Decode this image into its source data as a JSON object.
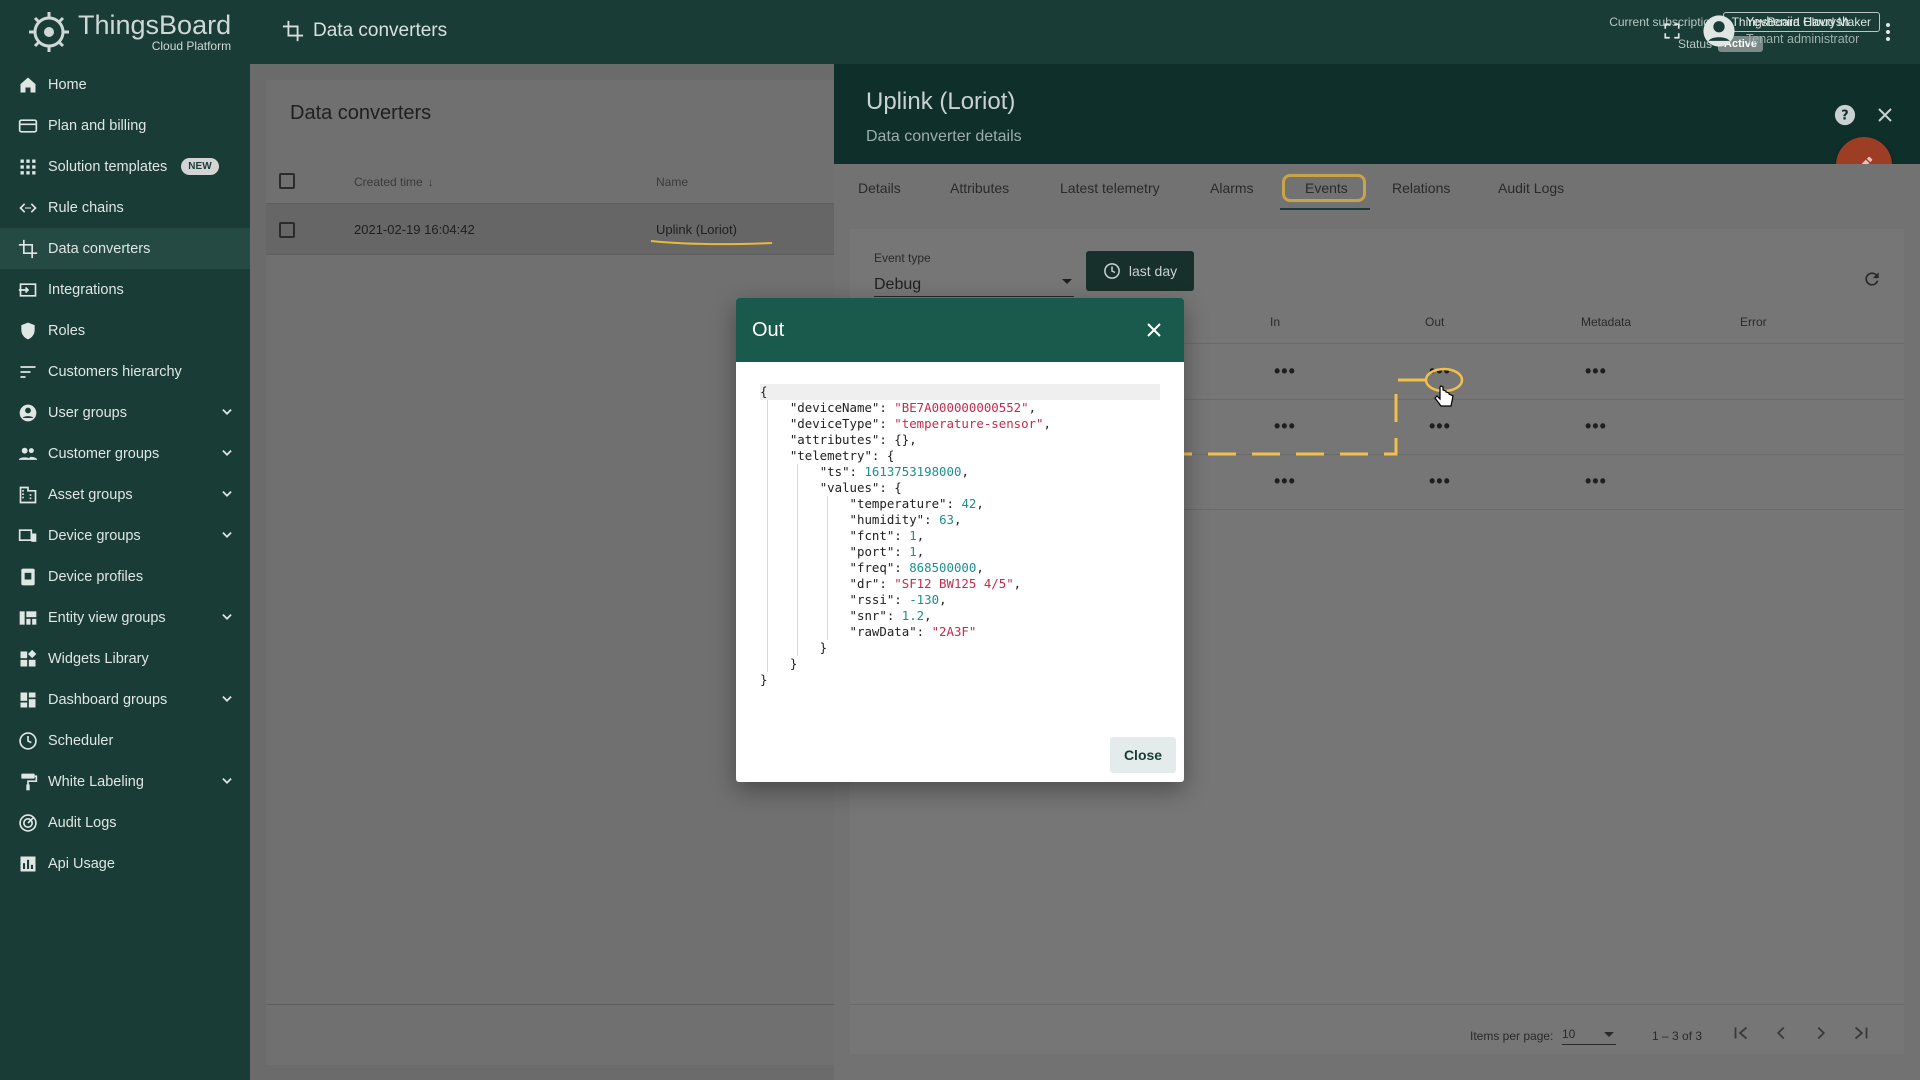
{
  "app": {
    "logo_title": "ThingsBoard",
    "logo_sub": "Cloud Platform"
  },
  "sidebar": {
    "items": [
      {
        "label": "Home",
        "icon": "home-icon"
      },
      {
        "label": "Plan and billing",
        "icon": "credit-card-icon"
      },
      {
        "label": "Solution templates",
        "icon": "apps-grid-icon",
        "badge": "NEW"
      },
      {
        "label": "Rule chains",
        "icon": "code-arrows-icon"
      },
      {
        "label": "Data converters",
        "icon": "crop-icon"
      },
      {
        "label": "Integrations",
        "icon": "input-icon"
      },
      {
        "label": "Roles",
        "icon": "shield-icon"
      },
      {
        "label": "Customers hierarchy",
        "icon": "sort-lines-icon"
      },
      {
        "label": "User groups",
        "icon": "account-circle-icon"
      },
      {
        "label": "Customer groups",
        "icon": "people-icon"
      },
      {
        "label": "Asset groups",
        "icon": "domain-icon"
      },
      {
        "label": "Device groups",
        "icon": "devices-icon"
      },
      {
        "label": "Device profiles",
        "icon": "device-profile-icon"
      },
      {
        "label": "Entity view groups",
        "icon": "view-quilt-icon"
      },
      {
        "label": "Widgets Library",
        "icon": "widgets-icon"
      },
      {
        "label": "Dashboard groups",
        "icon": "dashboard-icon"
      },
      {
        "label": "Scheduler",
        "icon": "clock-icon"
      },
      {
        "label": "White Labeling",
        "icon": "paint-roller-icon"
      },
      {
        "label": "Audit Logs",
        "icon": "track-changes-icon"
      },
      {
        "label": "Api Usage",
        "icon": "bar-chart-icon"
      }
    ]
  },
  "topbar": {
    "title": "Data converters",
    "subscription_label": "Current subscription",
    "subscription_value": "ThingsBoard Cloud Maker",
    "status_label": "Status",
    "status_value": "Active",
    "user_name": "Yevheniia Havrysh",
    "user_role": "Tenant administrator"
  },
  "list": {
    "title": "Data converters",
    "col_created": "Created time",
    "col_name": "Name",
    "rows": [
      {
        "created": "2021-02-19 16:04:42",
        "name": "Uplink (Loriot)"
      }
    ]
  },
  "details": {
    "title": "Uplink (Loriot)",
    "subtitle": "Data converter details",
    "tabs": [
      "Details",
      "Attributes",
      "Latest telemetry",
      "Alarms",
      "Events",
      "Relations",
      "Audit Logs"
    ],
    "active_tab": "Events",
    "event_type_label": "Event type",
    "event_type_value": "Debug",
    "time_button": "last day",
    "columns": [
      "In",
      "Out",
      "Metadata",
      "Error"
    ],
    "items_per_page_label": "Items per page:",
    "items_per_page_value": "10",
    "range": "1 – 3 of 3"
  },
  "dialog": {
    "title": "Out",
    "close_label": "Close",
    "code": [
      [
        [
          "p",
          "{"
        ]
      ],
      [
        [
          "p",
          "    "
        ],
        [
          "k",
          "\"deviceName\""
        ],
        [
          "p",
          ": "
        ],
        [
          "s",
          "\"BE7A000000000552\""
        ],
        [
          "p",
          ","
        ]
      ],
      [
        [
          "p",
          "    "
        ],
        [
          "k",
          "\"deviceType\""
        ],
        [
          "p",
          ": "
        ],
        [
          "s",
          "\"temperature-sensor\""
        ],
        [
          "p",
          ","
        ]
      ],
      [
        [
          "p",
          "    "
        ],
        [
          "k",
          "\"attributes\""
        ],
        [
          "p",
          ": {},"
        ]
      ],
      [
        [
          "p",
          "    "
        ],
        [
          "k",
          "\"telemetry\""
        ],
        [
          "p",
          ": {"
        ]
      ],
      [
        [
          "p",
          "        "
        ],
        [
          "k",
          "\"ts\""
        ],
        [
          "p",
          ": "
        ],
        [
          "n",
          "1613753198000"
        ],
        [
          "p",
          ","
        ]
      ],
      [
        [
          "p",
          "        "
        ],
        [
          "k",
          "\"values\""
        ],
        [
          "p",
          ": {"
        ]
      ],
      [
        [
          "p",
          "            "
        ],
        [
          "k",
          "\"temperature\""
        ],
        [
          "p",
          ": "
        ],
        [
          "n",
          "42"
        ],
        [
          "p",
          ","
        ]
      ],
      [
        [
          "p",
          "            "
        ],
        [
          "k",
          "\"humidity\""
        ],
        [
          "p",
          ": "
        ],
        [
          "n",
          "63"
        ],
        [
          "p",
          ","
        ]
      ],
      [
        [
          "p",
          "            "
        ],
        [
          "k",
          "\"fcnt\""
        ],
        [
          "p",
          ": "
        ],
        [
          "n",
          "1"
        ],
        [
          "p",
          ","
        ]
      ],
      [
        [
          "p",
          "            "
        ],
        [
          "k",
          "\"port\""
        ],
        [
          "p",
          ": "
        ],
        [
          "n",
          "1"
        ],
        [
          "p",
          ","
        ]
      ],
      [
        [
          "p",
          "            "
        ],
        [
          "k",
          "\"freq\""
        ],
        [
          "p",
          ": "
        ],
        [
          "n",
          "868500000"
        ],
        [
          "p",
          ","
        ]
      ],
      [
        [
          "p",
          "            "
        ],
        [
          "k",
          "\"dr\""
        ],
        [
          "p",
          ": "
        ],
        [
          "s",
          "\"SF12 BW125 4/5\""
        ],
        [
          "p",
          ","
        ]
      ],
      [
        [
          "p",
          "            "
        ],
        [
          "k",
          "\"rssi\""
        ],
        [
          "p",
          ": "
        ],
        [
          "n",
          "-130"
        ],
        [
          "p",
          ","
        ]
      ],
      [
        [
          "p",
          "            "
        ],
        [
          "k",
          "\"snr\""
        ],
        [
          "p",
          ": "
        ],
        [
          "n",
          "1.2"
        ],
        [
          "p",
          ","
        ]
      ],
      [
        [
          "p",
          "            "
        ],
        [
          "k",
          "\"rawData\""
        ],
        [
          "p",
          ": "
        ],
        [
          "s",
          "\"2A3F\""
        ]
      ],
      [
        [
          "p",
          "        }"
        ]
      ],
      [
        [
          "p",
          "    }"
        ]
      ],
      [
        [
          "p",
          "}"
        ]
      ]
    ]
  },
  "colors": {
    "sidebar": "#1a3c36",
    "dialog_header": "#1a5a4c",
    "fab": "#d14a2a",
    "annotation": "#f2c04a",
    "json_string": "#c62a4c",
    "json_number": "#1a8f8f"
  }
}
